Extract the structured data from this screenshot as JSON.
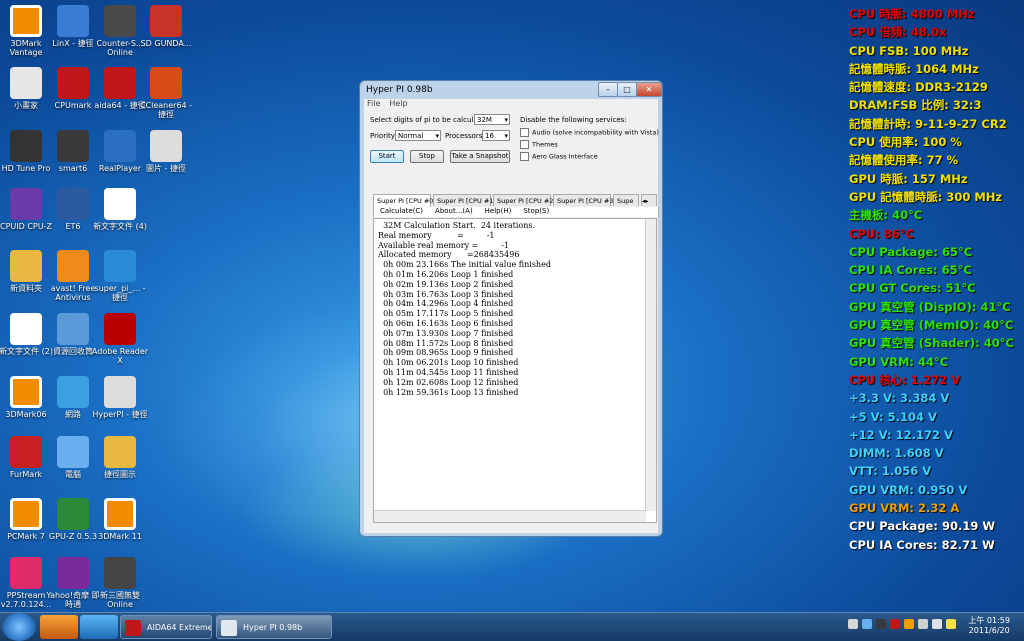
{
  "desktop_icons": [
    {
      "label": "3DMark Vantage"
    },
    {
      "label": "LinX - 捷徑"
    },
    {
      "label": "Counter-S... Online"
    },
    {
      "label": "SD GUNDA..."
    },
    {
      "label": "小畫家"
    },
    {
      "label": "CPUmark"
    },
    {
      "label": "aida64 - 捷徑"
    },
    {
      "label": "CCleaner64 - 捷徑"
    },
    {
      "label": "HD Tune Pro"
    },
    {
      "label": "smart6"
    },
    {
      "label": "RealPlayer"
    },
    {
      "label": "圖片 - 捷徑"
    },
    {
      "label": "CPUID CPU-Z"
    },
    {
      "label": "ET6"
    },
    {
      "label": "新文字文件 (4)"
    },
    {
      "label": "新資料夾"
    },
    {
      "label": "avast! Free Antivirus"
    },
    {
      "label": "super_pi_... - 捷徑"
    },
    {
      "label": "新文字文件 (2)"
    },
    {
      "label": "資源回收筒"
    },
    {
      "label": "Adobe Reader X"
    },
    {
      "label": "3DMark06"
    },
    {
      "label": "網路"
    },
    {
      "label": "HyperPI - 捷徑"
    },
    {
      "label": "FurMark"
    },
    {
      "label": "電腦"
    },
    {
      "label": "捷徑圖示"
    },
    {
      "label": "PCMark 7"
    },
    {
      "label": "GPU-Z 0.5.3"
    },
    {
      "label": "3DMark 11"
    },
    {
      "label": "PPStream v2.7.0.124..."
    },
    {
      "label": "Yahoo!奇摩 即時通"
    },
    {
      "label": "新三國無雙 Online"
    }
  ],
  "hud": [
    {
      "text": "CPU 時脈: 4800 MHz",
      "color": "#e00000"
    },
    {
      "text": "CPU 倍頻: 48.0x",
      "color": "#e00000"
    },
    {
      "text": "CPU FSB: 100 MHz",
      "color": "#f0e000"
    },
    {
      "text": "記憶體時脈: 1064 MHz",
      "color": "#f0e000"
    },
    {
      "text": "記憶體速度: DDR3-2129",
      "color": "#f0e000"
    },
    {
      "text": "DRAM:FSB 比例: 32:3",
      "color": "#f0e000"
    },
    {
      "text": "記憶體計時: 9-11-9-27 CR2",
      "color": "#f0e000"
    },
    {
      "text": "CPU 使用率: 100 %",
      "color": "#f0e000"
    },
    {
      "text": "記憶體使用率: 77 %",
      "color": "#f0e000"
    },
    {
      "text": "GPU 時脈: 157 MHz",
      "color": "#f0e000"
    },
    {
      "text": "GPU 記憶體時脈: 300 MHz",
      "color": "#f0e000"
    },
    {
      "text": "主機板: 40°C",
      "color": "#30e000"
    },
    {
      "text": "CPU: 86°C",
      "color": "#e00000"
    },
    {
      "text": "CPU Package: 65°C",
      "color": "#30e000"
    },
    {
      "text": "CPU IA Cores: 65°C",
      "color": "#30e000"
    },
    {
      "text": "CPU GT Cores: 51°C",
      "color": "#30e000"
    },
    {
      "text": "GPU 真空管 (DispIO): 41°C",
      "color": "#30e000"
    },
    {
      "text": "GPU 真空管 (MemIO): 40°C",
      "color": "#30e000"
    },
    {
      "text": "GPU 真空管 (Shader): 40°C",
      "color": "#30e000"
    },
    {
      "text": "GPU VRM: 44°C",
      "color": "#30e000"
    },
    {
      "text": "CPU 核心: 1.272 V",
      "color": "#e00000"
    },
    {
      "text": "+3.3 V: 3.384 V",
      "color": "#40d0ff"
    },
    {
      "text": "+5 V: 5.104 V",
      "color": "#40d0ff"
    },
    {
      "text": "+12 V: 12.172 V",
      "color": "#40d0ff"
    },
    {
      "text": "DIMM: 1.608 V",
      "color": "#40d0ff"
    },
    {
      "text": "VTT: 1.056 V",
      "color": "#40d0ff"
    },
    {
      "text": "GPU VRM: 0.950 V",
      "color": "#40d0ff"
    },
    {
      "text": "GPU VRM: 2.32 A",
      "color": "#f0a000"
    },
    {
      "text": "CPU Package: 90.19 W",
      "color": "#ffffff"
    },
    {
      "text": "CPU IA Cores: 82.71 W",
      "color": "#ffffff"
    }
  ],
  "window": {
    "title": "Hyper PI 0.98b",
    "menu": [
      "File",
      "Help"
    ],
    "digits_label": "Select digits of pi to be calculated:",
    "digits_value": "32M",
    "priority_label": "Priority:",
    "priority_value": "Normal",
    "processors_label": "Processors:",
    "processors_value": "16",
    "disable_label": "Disable the following services:",
    "checks": [
      "Audio (solve incompatibility with Vista)",
      "Themes",
      "Aero Glass Interface"
    ],
    "start": "Start",
    "stop": "Stop",
    "snapshot": "Take a Snapshot",
    "tabs": [
      "Super PI [CPU #0]",
      "Super PI [CPU #1]",
      "Super PI [CPU #2]",
      "Super PI [CPU #3]",
      "Supe"
    ],
    "submenu": [
      "Calculate(C)",
      "About...(A)",
      "Help(H)",
      "Stop(S)"
    ],
    "output": "  32M Calculation Start.  24 iterations.\nReal memory          =         -1\nAvailable real memory =         -1\nAllocated memory      =268435496\n  0h 00m 23.166s The initial value finished\n  0h 01m 16.206s Loop 1 finished\n  0h 02m 19.136s Loop 2 finished\n  0h 03m 16.763s Loop 3 finished\n  0h 04m 14.296s Loop 4 finished\n  0h 05m 17.117s Loop 5 finished\n  0h 06m 16.163s Loop 6 finished\n  0h 07m 13.930s Loop 7 finished\n  0h 08m 11.572s Loop 8 finished\n  0h 09m 08.965s Loop 9 finished\n  0h 10m 06.201s Loop 10 finished\n  0h 11m 04.545s Loop 11 finished\n  0h 12m 02.608s Loop 12 finished\n  0h 12m 59.361s Loop 13 finished"
  },
  "taskbar": {
    "tasks": [
      "AIDA64 Extreme ...",
      "Hyper PI 0.98b"
    ],
    "time": "上午 01:59",
    "date": "2011/6/20"
  }
}
